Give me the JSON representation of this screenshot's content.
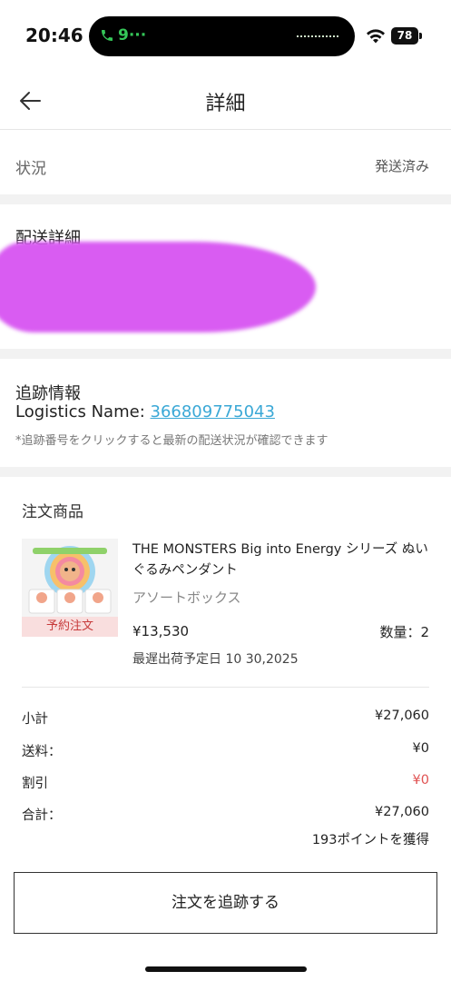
{
  "status_bar": {
    "time": "20:46",
    "call_label": "9···",
    "battery": "78"
  },
  "header": {
    "title": "詳細"
  },
  "status_row": {
    "label": "状況",
    "value": "発送済み"
  },
  "shipping": {
    "title": "配送詳細"
  },
  "tracking": {
    "title": "追跡情報",
    "logistics_label": "Logistics Name:",
    "tracking_number": "366809775043",
    "note": "*追跡番号をクリックすると最新の配送状況が確認できます"
  },
  "order": {
    "title": "注文商品",
    "item": {
      "name": "THE MONSTERS Big into Energy シリーズ ぬいぐるみペンダント",
      "variant": "アソートボックス",
      "price": "¥13,530",
      "quantity": "数量：2",
      "badge": "予約注文",
      "ship_date": "最遅出荷予定日 10 30,2025"
    }
  },
  "summary": {
    "subtotal_label": "小計",
    "subtotal": "¥27,060",
    "shipping_label": "送料：",
    "shipping": "¥0",
    "discount_label": "割引",
    "discount": "¥0",
    "total_label": "合計：",
    "total": "¥27,060",
    "points": "193ポイントを獲得"
  },
  "colors": {
    "link": "#3aa8d6",
    "discount": "#e05252",
    "preorder_bg": "#f9dede",
    "preorder_text": "#c73a3a"
  },
  "actions": {
    "track_button": "注文を追跡する"
  }
}
